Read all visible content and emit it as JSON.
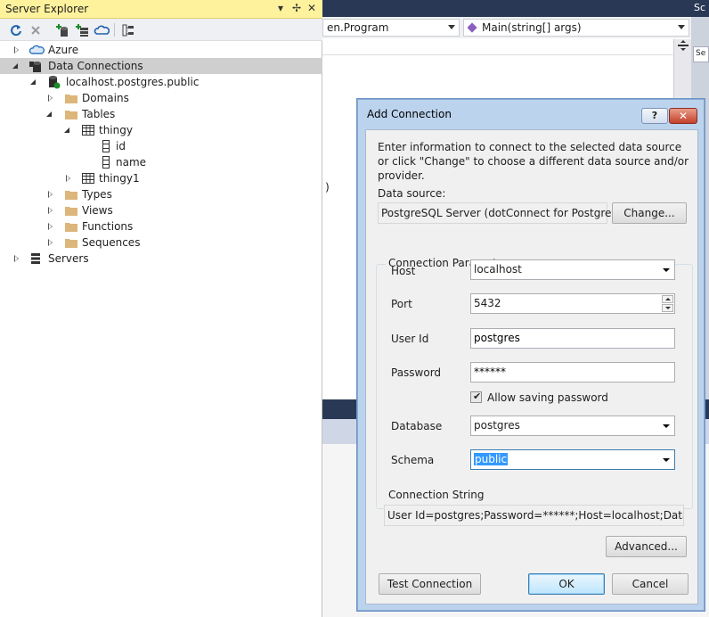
{
  "server_explorer": {
    "title": "Server Explorer",
    "title_controls": {
      "dropdown": "▾",
      "pin": "✢",
      "close": "✕"
    },
    "toolbar_icons": [
      "refresh-icon",
      "stop-icon",
      "connect-database-icon",
      "connect-server-icon",
      "connect-azure-icon",
      "show-designer-icon"
    ],
    "tree": [
      {
        "label": "Azure",
        "icon": "azure-cloud-icon",
        "level": 0,
        "state": "collapsed",
        "selected": false
      },
      {
        "label": "Data Connections",
        "icon": "data-connections-icon",
        "level": 0,
        "state": "expanded",
        "selected": true
      },
      {
        "label": "localhost.postgres.public",
        "icon": "database-connection-icon",
        "level": 1,
        "state": "expanded",
        "selected": false
      },
      {
        "label": "Domains",
        "icon": "folder-icon",
        "level": 2,
        "state": "collapsed",
        "selected": false
      },
      {
        "label": "Tables",
        "icon": "folder-icon",
        "level": 2,
        "state": "expanded",
        "selected": false
      },
      {
        "label": "thingy",
        "icon": "table-icon",
        "level": 3,
        "state": "expanded",
        "selected": false
      },
      {
        "label": "id",
        "icon": "column-icon",
        "level": 4,
        "state": "none",
        "selected": false
      },
      {
        "label": "name",
        "icon": "column-icon",
        "level": 4,
        "state": "none",
        "selected": false
      },
      {
        "label": "thingy1",
        "icon": "table-icon",
        "level": 3,
        "state": "collapsed",
        "selected": false
      },
      {
        "label": "Types",
        "icon": "folder-icon",
        "level": 2,
        "state": "collapsed",
        "selected": false
      },
      {
        "label": "Views",
        "icon": "folder-icon",
        "level": 2,
        "state": "collapsed",
        "selected": false
      },
      {
        "label": "Functions",
        "icon": "folder-icon",
        "level": 2,
        "state": "collapsed",
        "selected": false
      },
      {
        "label": "Sequences",
        "icon": "folder-icon",
        "level": 2,
        "state": "collapsed",
        "selected": false
      },
      {
        "label": "Servers",
        "icon": "servers-icon",
        "level": 0,
        "state": "collapsed",
        "selected": false
      }
    ]
  },
  "editor": {
    "nav_type": "en.Program",
    "nav_member": "Main(string[] args)",
    "code_fragment": ")",
    "right_tab": "Sc",
    "right_box": "Se"
  },
  "dialog": {
    "title": "Add Connection",
    "help_label": "?",
    "close_label": "✕",
    "description": "Enter information to connect to the selected data source or click \"Change\" to choose a different data source and/or provider.",
    "data_source_label": "Data source:",
    "data_source_value": "PostgreSQL Server (dotConnect for PostgreSQL)",
    "change_button": "Change...",
    "params_legend": "Connection Parameters",
    "host_label": "Host",
    "host_value": "localhost",
    "port_label": "Port",
    "port_value": "5432",
    "userid_label": "User Id",
    "userid_value": "postgres",
    "password_label": "Password",
    "password_value": "******",
    "allow_saving_label": "Allow saving password",
    "allow_saving_checked": true,
    "database_label": "Database",
    "database_value": "postgres",
    "schema_label": "Schema",
    "schema_value": "public",
    "cs_legend": "Connection String",
    "cs_value": "User Id=postgres;Password=******;Host=localhost;Database=postgres",
    "advanced_button": "Advanced...",
    "test_button": "Test Connection",
    "ok_button": "OK",
    "cancel_button": "Cancel"
  },
  "colors": {
    "title_yellow": "#fff29d",
    "selection_gray": "#cfcfcf",
    "dark_tab": "#293955",
    "highlight_blue": "#3399ff"
  }
}
